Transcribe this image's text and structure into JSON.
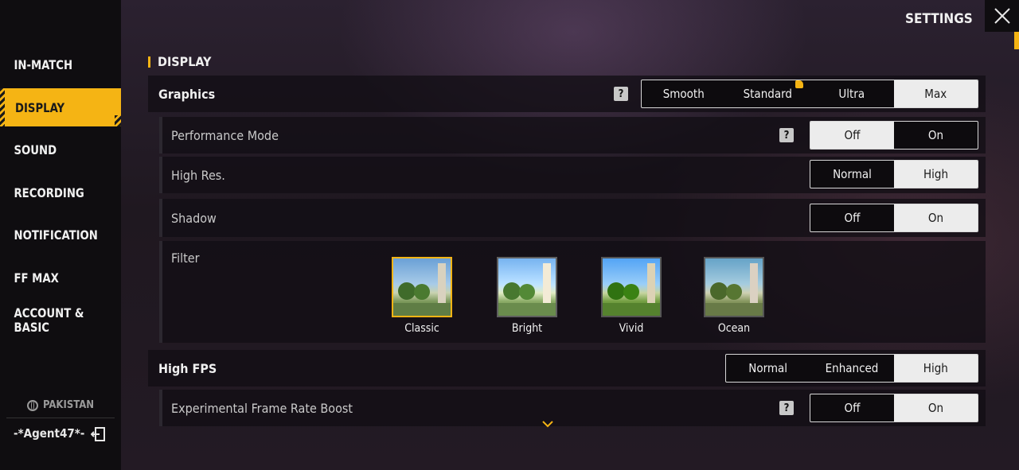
{
  "header": {
    "title": "SETTINGS"
  },
  "sidebar": {
    "items": [
      {
        "label": "IN-MATCH"
      },
      {
        "label": "DISPLAY",
        "active": true
      },
      {
        "label": "SOUND"
      },
      {
        "label": "RECORDING"
      },
      {
        "label": "NOTIFICATION"
      },
      {
        "label": "FF MAX"
      },
      {
        "label": "ACCOUNT &\nBASIC"
      }
    ],
    "region": "PAKISTAN",
    "player_name": "-*Agent47*-"
  },
  "section": {
    "title": "DISPLAY"
  },
  "graphics": {
    "label": "Graphics",
    "help": "?",
    "options": [
      "Smooth",
      "Standard",
      "Ultra",
      "Max"
    ],
    "selected": "Max",
    "recommended": "Standard"
  },
  "performance_mode": {
    "label": "Performance Mode",
    "help": "?",
    "options": [
      "Off",
      "On"
    ],
    "selected": "Off"
  },
  "high_res": {
    "label": "High Res.",
    "options": [
      "Normal",
      "High"
    ],
    "selected": "High"
  },
  "shadow": {
    "label": "Shadow",
    "options": [
      "Off",
      "On"
    ],
    "selected": "On"
  },
  "filter": {
    "label": "Filter",
    "options": [
      "Classic",
      "Bright",
      "Vivid",
      "Ocean"
    ],
    "selected": "Classic"
  },
  "high_fps": {
    "label": "High FPS",
    "options": [
      "Normal",
      "Enhanced",
      "High"
    ],
    "selected": "High"
  },
  "frame_boost": {
    "label": "Experimental Frame Rate Boost",
    "help": "?",
    "options": [
      "Off",
      "On"
    ],
    "selected": "On"
  },
  "colors": {
    "accent": "#f5b414",
    "selected_bg": "#ececec"
  }
}
